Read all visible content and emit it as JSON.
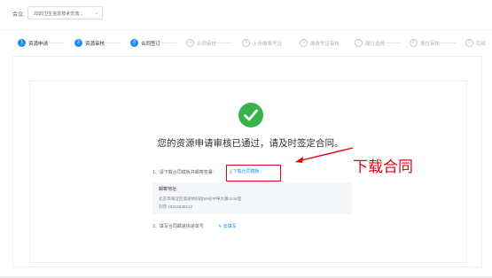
{
  "topbar": {
    "meeting_label": "会议:",
    "meeting_value": "2020卫生信息技术交流...",
    "chevron": "⌄"
  },
  "steps": [
    {
      "num": "1",
      "label": "资源申请",
      "state": "done"
    },
    {
      "num": "2",
      "label": "资源审核",
      "state": "done"
    },
    {
      "num": "3",
      "label": "合同签订",
      "state": "current"
    },
    {
      "num": "4",
      "label": "合同审核",
      "state": "pending"
    },
    {
      "num": "5",
      "label": "上传缴费凭证",
      "state": "pending"
    },
    {
      "num": "6",
      "label": "缴费凭证审核",
      "state": "pending"
    },
    {
      "num": "7",
      "label": "展位选择",
      "state": "pending"
    },
    {
      "num": "8",
      "label": "展位审核",
      "state": "pending"
    },
    {
      "num": "9",
      "label": "完成",
      "state": "pending"
    }
  ],
  "main": {
    "headline": "您的资源申请审核已通过，请及时签定合同。",
    "step1_text": "1、请下载合同模板并邮寄签署:",
    "download_link": "下载合同模板",
    "address_title": "邮寄地址:",
    "address_line1": "北京市海淀区高梁桥斜街59号中坤大厦1518室",
    "address_line2": "刘莎 15011546112",
    "step2_text": "2、填写合同邮递快递单号",
    "fill_link": "去填写"
  },
  "annotation": {
    "text": "下载合同"
  },
  "colors": {
    "primary": "#1a8cff",
    "success": "#37b34a",
    "annotation_red": "#e60012"
  }
}
